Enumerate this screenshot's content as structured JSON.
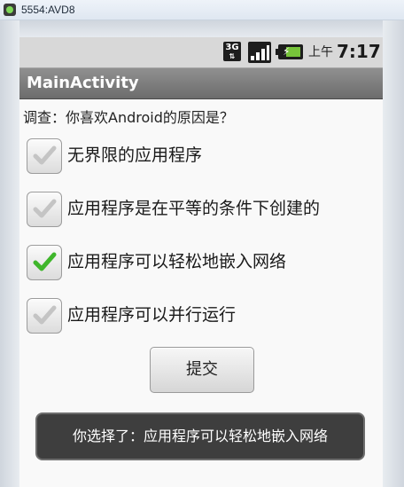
{
  "window": {
    "title": "5554:AVD8"
  },
  "status_bar": {
    "network": "3G",
    "ampm": "上午",
    "time": "7:17",
    "icons": [
      "3g-icon",
      "signal-icon",
      "battery-charging-icon"
    ]
  },
  "app": {
    "title": "MainActivity"
  },
  "survey": {
    "question": "调查：你喜欢Android的原因是？",
    "options": [
      {
        "label": "无界限的应用程序",
        "checked": false
      },
      {
        "label": "应用程序是在平等的条件下创建的",
        "checked": false
      },
      {
        "label": "应用程序可以轻松地嵌入网络",
        "checked": true
      },
      {
        "label": "应用程序可以并行运行",
        "checked": false
      }
    ],
    "submit_label": "提交"
  },
  "toast": {
    "message": "你选择了：应用程序可以轻松地嵌入网络"
  },
  "colors": {
    "check_on": "#3fb62b",
    "check_off": "#c4c4c4",
    "action_bar": "#7a7a7a",
    "status_bar": "#d8d8d8",
    "toast_bg": "#3e3e3e"
  }
}
